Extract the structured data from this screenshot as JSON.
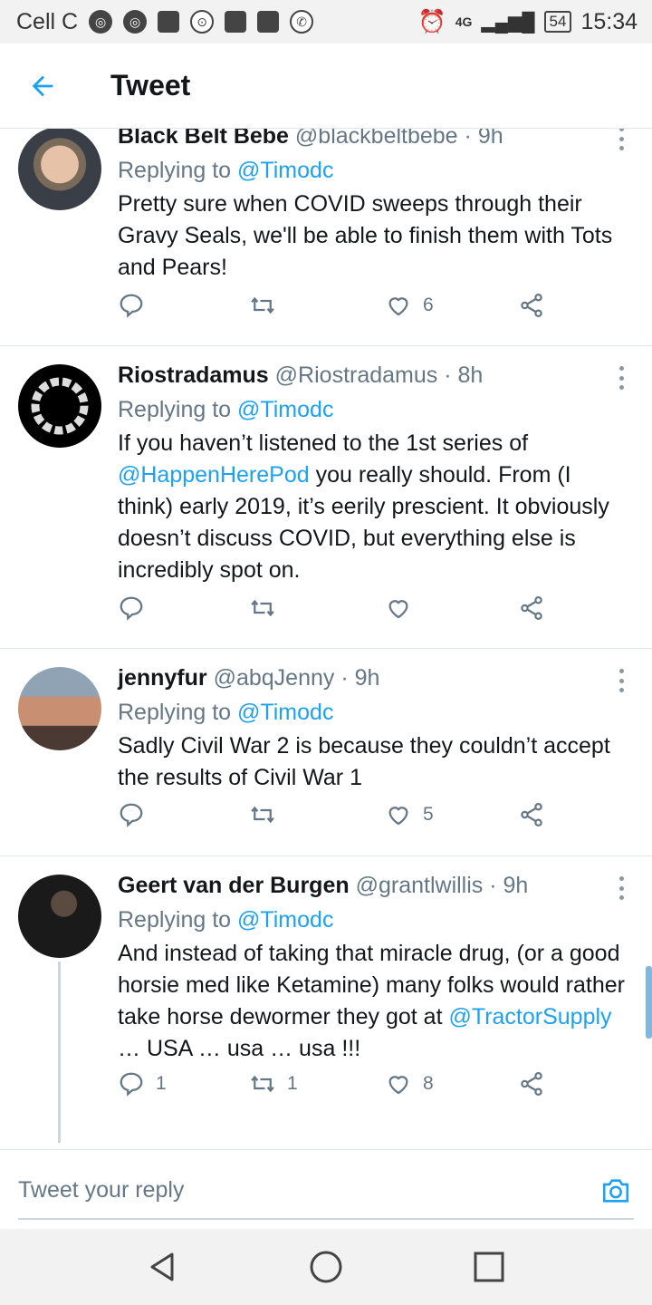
{
  "status_bar": {
    "carrier": "Cell C",
    "network": "4G",
    "battery": "54",
    "time": "15:34"
  },
  "header": {
    "title": "Tweet"
  },
  "tweets": [
    {
      "name": "Black Belt Bebe",
      "handle": "@blackbeltbebe",
      "time": "· 9h",
      "replying_label": "Replying to",
      "replying_to": "@Timodc",
      "body_parts": [
        {
          "text": "Pretty sure when COVID sweeps through their Gravy Seals, we'll be able to finish them with Tots and Pears!",
          "link": false
        }
      ],
      "replies": "",
      "retweets": "",
      "likes": "6"
    },
    {
      "name": "Riostradamus",
      "handle": "@Riostradamus",
      "time": "· 8h",
      "replying_label": "Replying to",
      "replying_to": "@Timodc",
      "body_parts": [
        {
          "text": "If you haven’t listened to the 1st series of ",
          "link": false
        },
        {
          "text": "@HappenHerePod",
          "link": true
        },
        {
          "text": " you really should.  From (I think) early 2019, it’s eerily prescient.  It obviously doesn’t discuss COVID, but everything else is incredibly spot on.",
          "link": false
        }
      ],
      "replies": "",
      "retweets": "",
      "likes": ""
    },
    {
      "name": "jennyfur",
      "handle": "@abqJenny",
      "time": "· 9h",
      "replying_label": "Replying to",
      "replying_to": "@Timodc",
      "body_parts": [
        {
          "text": "Sadly Civil War 2 is because they couldn’t accept the results of Civil War 1",
          "link": false
        }
      ],
      "replies": "",
      "retweets": "",
      "likes": "5"
    },
    {
      "name": "Geert van der Burgen",
      "handle": "@grantlwillis",
      "time": "· 9h",
      "replying_label": "Replying to",
      "replying_to": "@Timodc",
      "body_parts": [
        {
          "text": "And instead of taking that miracle drug, (or a good horsie med like Ketamine) many folks would rather take horse dewormer they got at ",
          "link": false
        },
        {
          "text": "@TractorSupply",
          "link": true
        },
        {
          "text": " … USA … usa … usa !!!",
          "link": false
        }
      ],
      "replies": "1",
      "retweets": "1",
      "likes": "8"
    }
  ],
  "composer": {
    "placeholder": "Tweet your reply"
  }
}
